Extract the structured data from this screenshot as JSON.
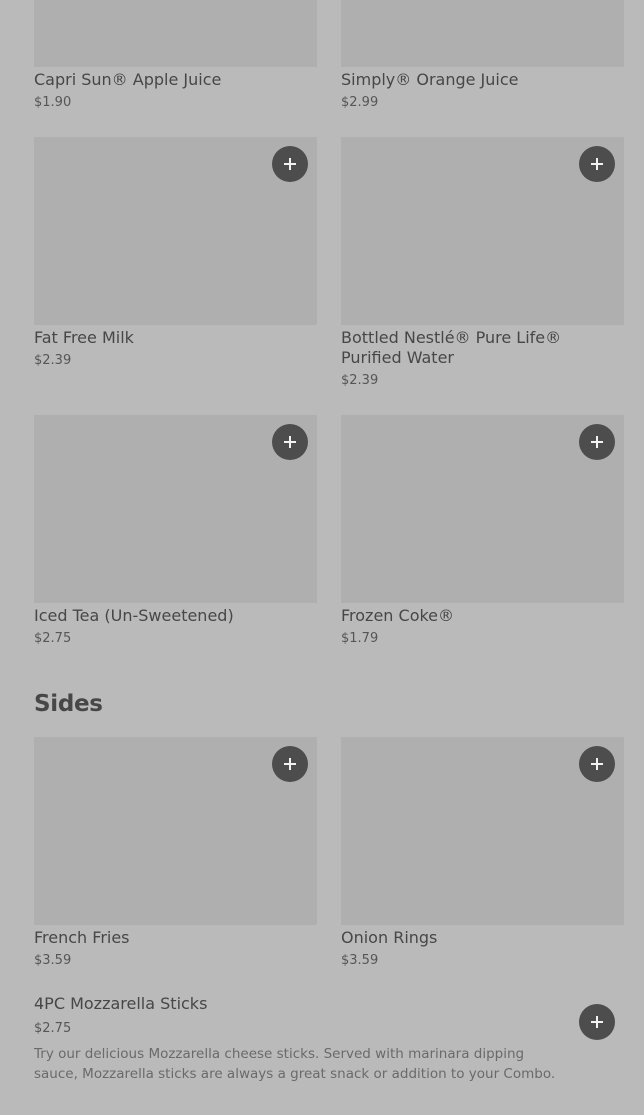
{
  "drinks": [
    {
      "name": "Capri Sun® Apple Juice",
      "price": "$1.90"
    },
    {
      "name": "Simply® Orange Juice",
      "price": "$2.99"
    },
    {
      "name": "Fat Free Milk",
      "price": "$2.39"
    },
    {
      "name": "Bottled Nestlé® Pure Life® Purified Water",
      "price": "$2.39"
    },
    {
      "name": "Iced Tea (Un-Sweetened)",
      "price": "$2.75"
    },
    {
      "name": "Frozen Coke®",
      "price": "$1.79"
    }
  ],
  "sides": {
    "title": "Sides",
    "items": [
      {
        "name": "French Fries",
        "price": "$3.59"
      },
      {
        "name": "Onion Rings",
        "price": "$3.59"
      }
    ],
    "row_item": {
      "name": "4PC Mozzarella Sticks",
      "price": "$2.75",
      "description": "Try our delicious Mozzarella cheese sticks. Served with marinara dipping sauce, Mozzarella sticks are always a great snack or addition to your Combo."
    }
  },
  "icons": {
    "add": "plus-icon"
  },
  "colors": {
    "background": "#bababa",
    "image_placeholder": "#afafaf",
    "add_button": "#4d4d4d"
  }
}
